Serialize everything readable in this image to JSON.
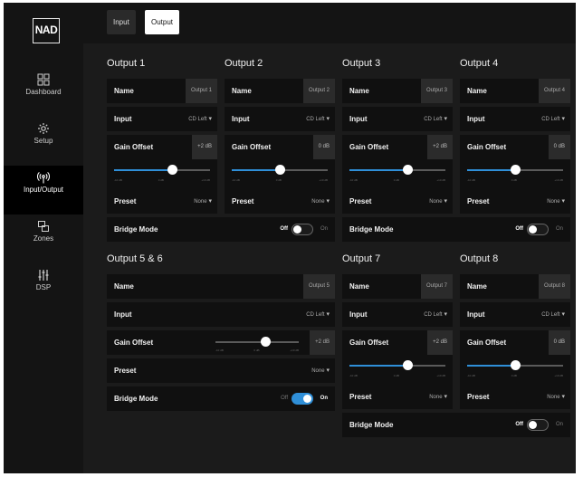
{
  "logo": "NAD",
  "nav": [
    {
      "label": "Dashboard",
      "icon": "grid-icon"
    },
    {
      "label": "Setup",
      "icon": "gear-icon"
    },
    {
      "label": "Input/Output",
      "icon": "antenna-icon"
    },
    {
      "label": "Zones",
      "icon": "zones-icon"
    },
    {
      "label": "DSP",
      "icon": "sliders-icon"
    }
  ],
  "tabs": [
    "Input",
    "Output"
  ],
  "labels": {
    "name": "Name",
    "input": "Input",
    "gain": "Gain Offset",
    "preset": "Preset",
    "bridge": "Bridge Mode",
    "off": "Off",
    "on": "On"
  },
  "ticks": [
    "-10 dB",
    "0 dB",
    "+10 dB"
  ],
  "outputs": [
    {
      "title": "Output 1",
      "name": "Output 1",
      "input": "CD Left",
      "gain": "+2 dB",
      "gain_level": 0.6,
      "preset": "None"
    },
    {
      "title": "Output 2",
      "name": "Output 2",
      "input": "CD Left",
      "gain": "0 dB",
      "gain_level": 0.5,
      "preset": "None"
    },
    {
      "title": "Output 3",
      "name": "Output 3",
      "input": "CD Left",
      "gain": "+2 dB",
      "gain_level": 0.6,
      "preset": "None"
    },
    {
      "title": "Output 4",
      "name": "Output 4",
      "input": "CD Left",
      "gain": "0 dB",
      "gain_level": 0.5,
      "preset": "None"
    },
    {
      "title": "Output 5 & 6",
      "name": "Output 5",
      "input": "CD Left",
      "gain": "+2 dB",
      "gain_level": 0.6,
      "preset": "None"
    },
    {
      "title": "Output 7",
      "name": "Output 7",
      "input": "CD Left",
      "gain": "+2 dB",
      "gain_level": 0.6,
      "preset": "None"
    },
    {
      "title": "Output 8",
      "name": "Output 8",
      "input": "CD Left",
      "gain": "0 dB",
      "gain_level": 0.5,
      "preset": "None"
    }
  ],
  "bridges": [
    {
      "state": "Off"
    },
    {
      "state": "Off"
    },
    {
      "state": "On"
    },
    {
      "state": "Off"
    }
  ],
  "colors": {
    "accent": "#2f8fd8",
    "background": "#1b1b1b",
    "row": "#101010"
  }
}
